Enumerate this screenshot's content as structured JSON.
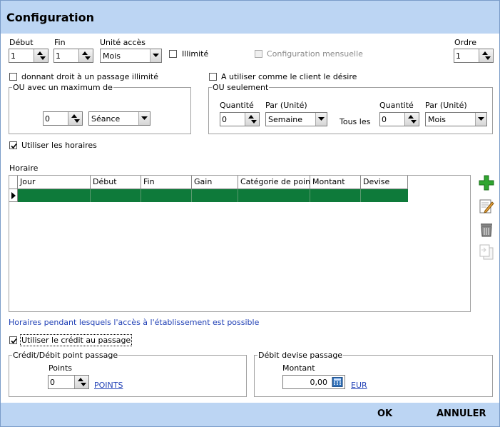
{
  "title": "Configuration",
  "debut": {
    "label": "Début",
    "value": "1"
  },
  "fin": {
    "label": "Fin",
    "value": "1"
  },
  "unite": {
    "label": "Unité accès",
    "value": "Mois"
  },
  "illimite": {
    "label": "Illimité"
  },
  "config_mensuelle": {
    "label": "Configuration mensuelle"
  },
  "ordre": {
    "label": "Ordre",
    "value": "1"
  },
  "donnant_droit": {
    "label": "donnant droit à un passage illimité"
  },
  "a_utiliser": {
    "label": "A utiliser comme le client le désire"
  },
  "ou_max": {
    "legend": "OU avec un maximum de",
    "qty": "0",
    "unit": "Séance"
  },
  "ou_seulement": {
    "legend": "OU seulement",
    "qty_label": "Quantité",
    "qty": "0",
    "par_label": "Par (Unité)",
    "par": "Semaine",
    "tous_les": "Tous les",
    "qty2_label": "Quantité",
    "qty2": "0",
    "par2_label": "Par (Unité)",
    "par2": "Mois"
  },
  "utiliser_horaires": {
    "label": "Utiliser les horaires",
    "checked": true
  },
  "horaire": {
    "label": "Horaire",
    "columns": [
      "Jour",
      "Début",
      "Fin",
      "Gain",
      "Catégorie de poin",
      "Montant",
      "Devise"
    ],
    "row_color": "#0e7a3a",
    "note": "Horaires pendant lesquels l'accès à l'établissement est possible"
  },
  "tools": [
    "add-icon",
    "edit-icon",
    "delete-icon",
    "copy-icon"
  ],
  "utiliser_credit": {
    "label": "Utiliser le crédit au passage",
    "checked": true
  },
  "credit_point": {
    "legend": "Crédit/Débit point passage",
    "points_label": "Points",
    "points": "0",
    "link": "POINTS"
  },
  "debit_devise": {
    "legend": "Débit devise passage",
    "montant_label": "Montant",
    "montant": "0,00",
    "link": "EUR"
  },
  "buttons": {
    "ok": "OK",
    "annuler": "ANNULER"
  },
  "accent": "#bcd5f3"
}
